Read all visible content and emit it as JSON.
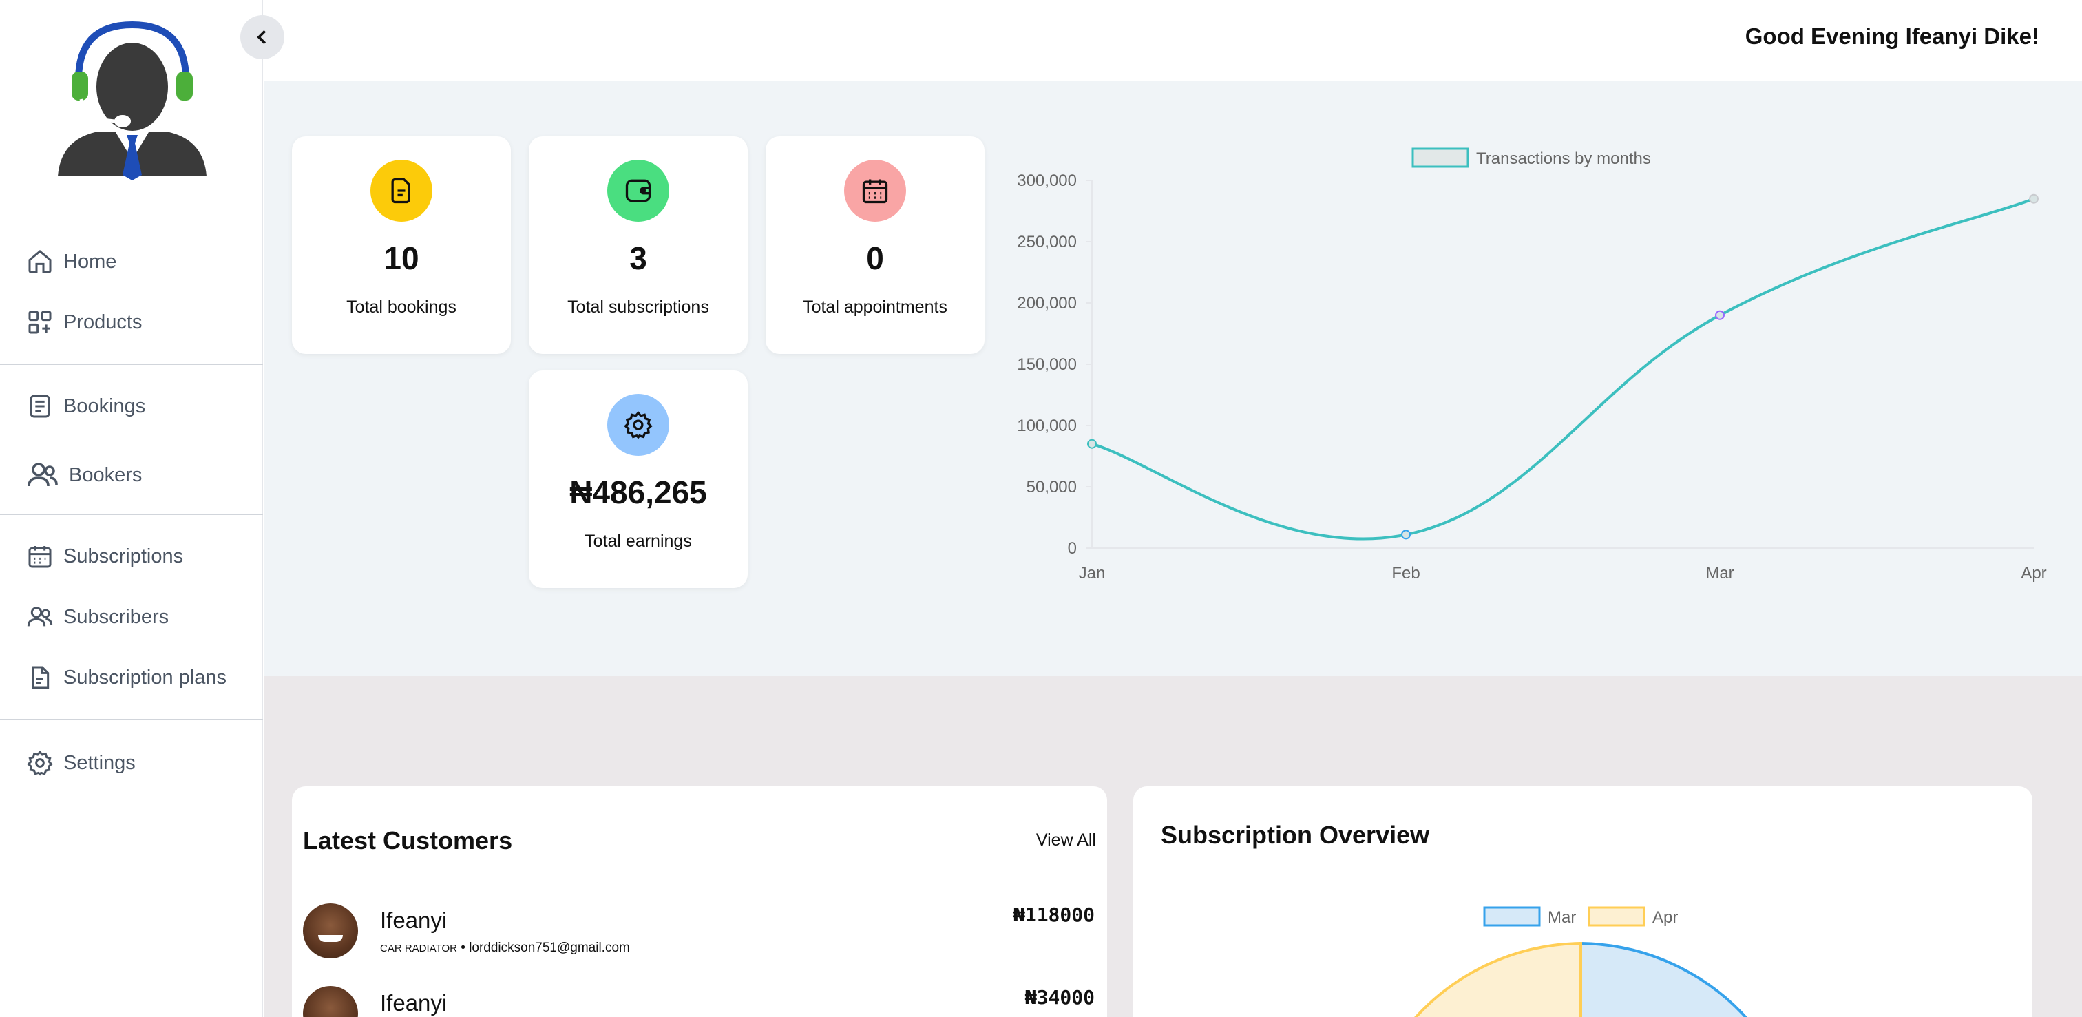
{
  "header": {
    "greeting": "Good Evening Ifeanyi Dike!"
  },
  "sidebar": {
    "items": [
      {
        "label": "Home",
        "icon": "home-icon"
      },
      {
        "label": "Products",
        "icon": "grid-plus-icon"
      },
      {
        "label": "Bookings",
        "icon": "list-icon"
      },
      {
        "label": "Bookers",
        "icon": "users-icon"
      },
      {
        "label": "Subscriptions",
        "icon": "calendar-icon"
      },
      {
        "label": "Subscribers",
        "icon": "users-icon"
      },
      {
        "label": "Subscription plans",
        "icon": "document-icon"
      },
      {
        "label": "Settings",
        "icon": "gear-icon"
      }
    ]
  },
  "stats": [
    {
      "value": "10",
      "label": "Total bookings",
      "icon": "note-icon",
      "color": "#FCCB0A"
    },
    {
      "value": "3",
      "label": "Total subscriptions",
      "icon": "wallet-icon",
      "color": "#4ADE80"
    },
    {
      "value": "0",
      "label": "Total appointments",
      "icon": "calendar-icon",
      "color": "#F9A5A5"
    },
    {
      "value": "₦486,265",
      "label": "Total earnings",
      "icon": "gear-icon",
      "color": "#93C5FD"
    }
  ],
  "chart_data": {
    "type": "line",
    "categories": [
      "Jan",
      "Feb",
      "Mar",
      "Apr"
    ],
    "series": [
      {
        "name": "Transactions by months",
        "values": [
          85000,
          11000,
          190000,
          285000
        ]
      }
    ],
    "ylim": [
      0,
      300000
    ],
    "yticks": [
      "0",
      "50,000",
      "100,000",
      "150,000",
      "200,000",
      "250,000",
      "300,000"
    ],
    "legend": "top-center",
    "color": "#3CBFBF"
  },
  "customers": {
    "title": "Latest Customers",
    "view_all": "View All",
    "rows": [
      {
        "name": "Ifeanyi",
        "category": "CAR RADIATOR",
        "email": "lorddickson751@gmail.com",
        "amount": "₦118000"
      },
      {
        "name": "Ifeanyi",
        "category": "",
        "email": "",
        "amount": "₦34000"
      }
    ]
  },
  "subscription_overview": {
    "title": "Subscription Overview",
    "legend": [
      {
        "label": "Mar",
        "color": "#36A2EB"
      },
      {
        "label": "Apr",
        "color": "#FFCE56"
      }
    ]
  }
}
